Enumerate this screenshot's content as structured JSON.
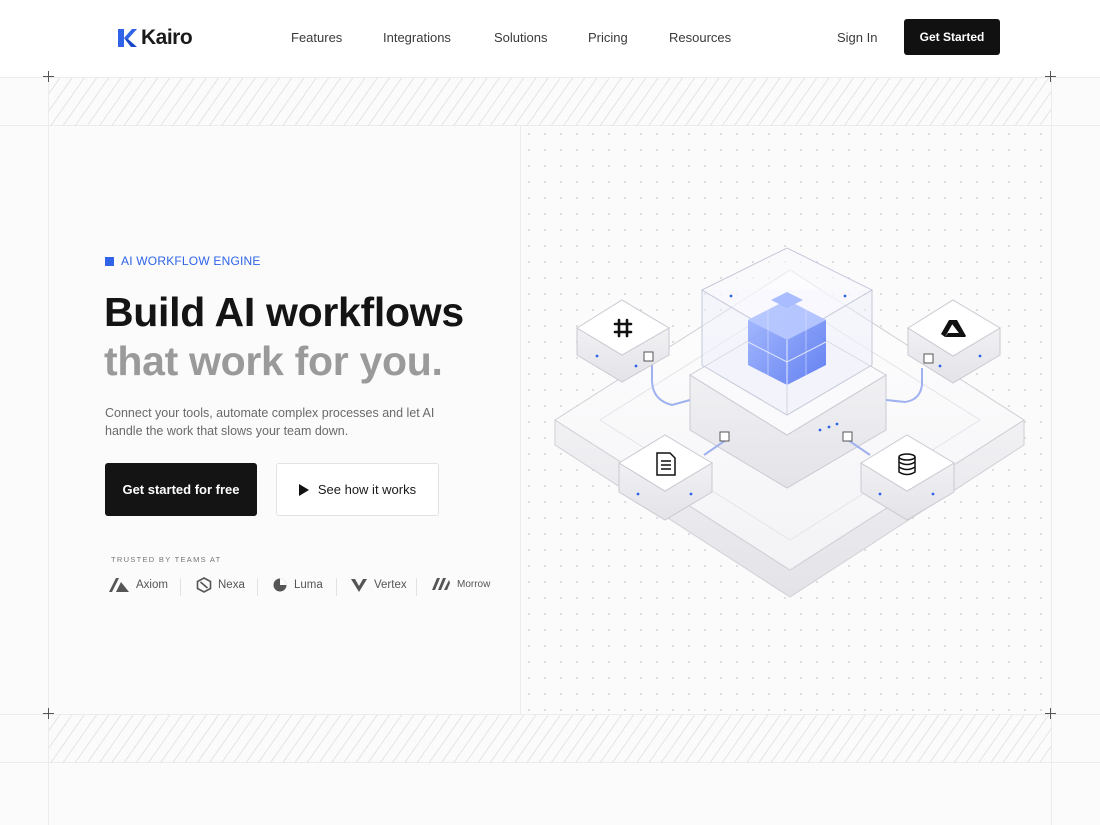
{
  "brand": {
    "name": "Kairo",
    "accent": "#2f64e8"
  },
  "nav": {
    "links": [
      "Features",
      "Integrations",
      "Solutions",
      "Pricing",
      "Resources"
    ],
    "sign_in": "Sign In",
    "cta": "Get Started"
  },
  "hero": {
    "eyebrow": "AI WORKFLOW ENGINE",
    "headline_line1": "Build AI workflows",
    "headline_line2": "that work for you.",
    "subtext": "Connect your tools, automate complex processes and let AI handle the work that slows your team down.",
    "primary_cta": "Get started for free",
    "secondary_cta": "See how it works",
    "secondary_cta_icon": "play-icon"
  },
  "trusted": {
    "label": "TRUSTED BY TEAMS AT",
    "companies": [
      {
        "name": "Axiom",
        "icon": "axiom-logo-icon"
      },
      {
        "name": "Nexa",
        "icon": "nexa-logo-icon"
      },
      {
        "name": "Luma",
        "icon": "luma-logo-icon"
      },
      {
        "name": "Vertex",
        "icon": "vertex-logo-icon"
      },
      {
        "name": "Morrow",
        "icon": "morrow-logo-icon"
      }
    ]
  },
  "illustration": {
    "nodes": [
      "slack-icon",
      "google-drive-icon",
      "document-icon",
      "database-icon"
    ],
    "core": "ai-cube-icon"
  }
}
